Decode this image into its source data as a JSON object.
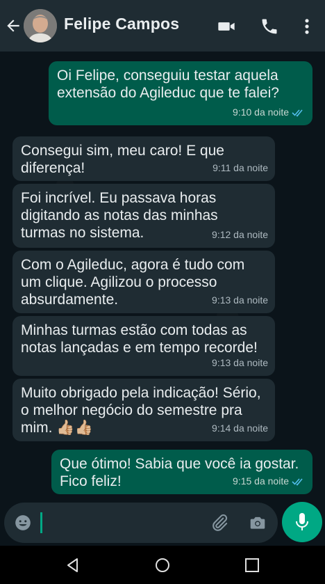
{
  "header": {
    "contact_name": "Felipe Campos"
  },
  "messages": [
    {
      "direction": "out",
      "text": "Oi Felipe, conseguiu testar aquela\nextensão do Agileduc que te falei?",
      "time": "9:10 da noite"
    },
    {
      "direction": "in",
      "text": "Consegui sim, meu caro! E que\ndiferença!",
      "time": "9:11 da noite"
    },
    {
      "direction": "in",
      "text": "Foi incrível. Eu passava horas\ndigitando as notas das minhas\nturmas no sistema.",
      "time": "9:12 da noite"
    },
    {
      "direction": "in",
      "text": "Com o Agileduc, agora é tudo com\num clique. Agilizou o processo\nabsurdamente.",
      "time": "9:13 da noite"
    },
    {
      "direction": "in",
      "text": "Minhas turmas estão com todas as\nnotas lançadas e em tempo recorde!",
      "time": "9:13 da noite"
    },
    {
      "direction": "in",
      "text": "Muito obrigado pela indicação! Sério,\no melhor negócio do semestre pra\nmim. 👍🏼👍🏼",
      "time": "9:14 da noite"
    },
    {
      "direction": "out",
      "text": "Que ótimo! Sabia que você ia gostar.\nFico feliz!",
      "time": "9:15 da noite"
    }
  ],
  "colors": {
    "header": "#1f2c33",
    "incoming": "#1f2c33",
    "outgoing": "#005c4b",
    "accent": "#00a884",
    "read_ticks": "#53bdeb"
  }
}
